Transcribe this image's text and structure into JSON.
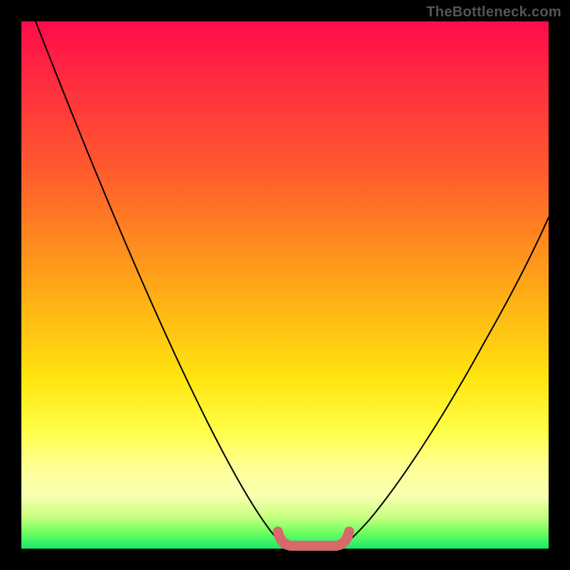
{
  "watermark": {
    "text": "TheBottleneck.com"
  },
  "colors": {
    "gradient_top": "#ff0b4b",
    "gradient_bottom": "#18e86b",
    "curve": "#000000",
    "flat_marker": "#d9686b",
    "frame": "#000000"
  },
  "chart_data": {
    "type": "line",
    "title": "",
    "xlabel": "",
    "ylabel": "",
    "xlim": [
      0,
      100
    ],
    "ylim": [
      0,
      100
    ],
    "grid": false,
    "legend": false,
    "annotations": [
      "TheBottleneck.com"
    ],
    "series": [
      {
        "name": "left-branch",
        "x": [
          0,
          5,
          10,
          15,
          20,
          25,
          30,
          35,
          40,
          43,
          46,
          48,
          50
        ],
        "y": [
          100,
          90,
          80,
          70,
          60,
          50,
          39,
          28,
          16,
          9,
          4,
          1,
          0
        ]
      },
      {
        "name": "right-branch",
        "x": [
          60,
          63,
          66,
          70,
          75,
          80,
          85,
          90,
          95,
          100
        ],
        "y": [
          0,
          1,
          3,
          7,
          14,
          23,
          33,
          44,
          54,
          63
        ]
      },
      {
        "name": "flat-bottom-marker",
        "x": [
          48,
          50,
          52,
          55,
          58,
          60,
          62
        ],
        "y": [
          2,
          0.5,
          0,
          0,
          0,
          0.5,
          2
        ]
      }
    ]
  }
}
